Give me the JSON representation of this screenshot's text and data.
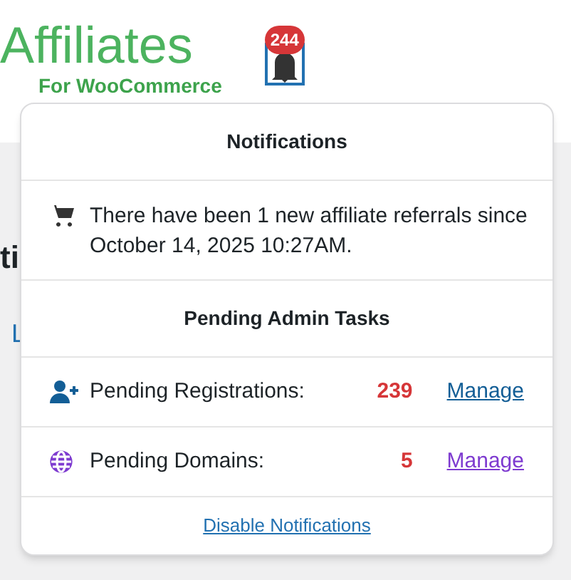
{
  "logo": {
    "title": "Affiliates",
    "subtitle": "For WooCommerce"
  },
  "bell": {
    "count": "244"
  },
  "background": {
    "heading_fragment": "ti",
    "link_fragment": "L"
  },
  "notifications": {
    "title": "Notifications",
    "message": "There have been 1 new affiliate referrals since October 14, 2025 10:27AM.",
    "tasks_title": "Pending Admin Tasks",
    "tasks": [
      {
        "kind": "registrations",
        "label": "Pending Registrations:",
        "count": "239",
        "action": "Manage",
        "color": "#135e96"
      },
      {
        "kind": "domains",
        "label": "Pending Domains:",
        "count": "5",
        "action": "Manage",
        "color": "#7e3bd0"
      }
    ],
    "footer_link": "Disable Notifications"
  }
}
